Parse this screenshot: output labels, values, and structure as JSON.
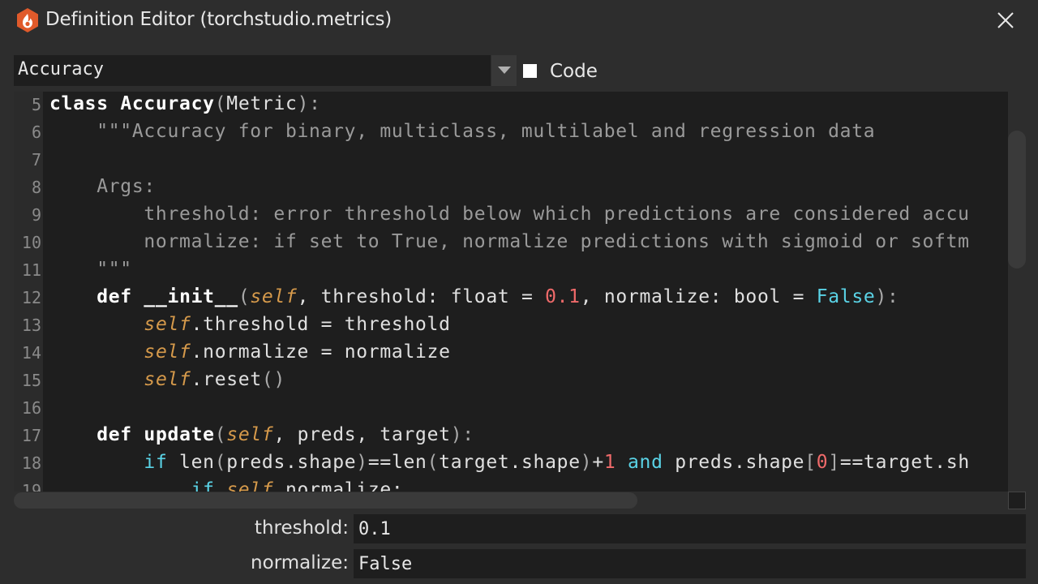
{
  "window": {
    "title": "Definition Editor (torchstudio.metrics)"
  },
  "toolbar": {
    "selected_definition": "Accuracy",
    "code_checkbox_label": "Code",
    "code_checked": true
  },
  "editor": {
    "line_numbers": [
      "5",
      "6",
      "7",
      "8",
      "9",
      "10",
      "11",
      "12",
      "13",
      "14",
      "15",
      "16",
      "17",
      "18",
      "19"
    ]
  },
  "params": [
    {
      "label": "threshold:",
      "value": "0.1"
    },
    {
      "label": "normalize:",
      "value": "False"
    }
  ],
  "icons": {
    "app": "torchstudio-flame-icon",
    "close": "close-icon",
    "dropdown": "chevron-down-icon"
  },
  "colors": {
    "app_icon": "#e05a2b",
    "keyword": "#ffffff",
    "docstring": "#9a9a9a",
    "self": "#d69a4b",
    "number": "#ef6a6a",
    "builtin": "#5ad3e6"
  }
}
